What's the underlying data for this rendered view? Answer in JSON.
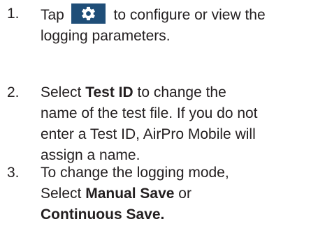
{
  "icon_colors": {
    "gear_background": "#1f4e78",
    "gear_foreground": "#ffffff"
  },
  "steps": [
    {
      "number": "1.",
      "icon": "gear-icon",
      "before_icon": "Tap",
      "after_icon": "to configure or view the",
      "line2": "logging parameters."
    },
    {
      "number": "2.",
      "prefix": "Select ",
      "bold": "Test ID",
      "suffix": " to change the",
      "lines": [
        "name of the test file. If you do not",
        "enter a Test ID, AirPro Mobile will",
        "assign a name."
      ]
    },
    {
      "number": "3.",
      "line1": "To change the logging mode,",
      "line2_prefix": "Select ",
      "line2_bold": "Manual Save",
      "line2_suffix": " or",
      "line3_bold": "Continuous Save."
    }
  ]
}
